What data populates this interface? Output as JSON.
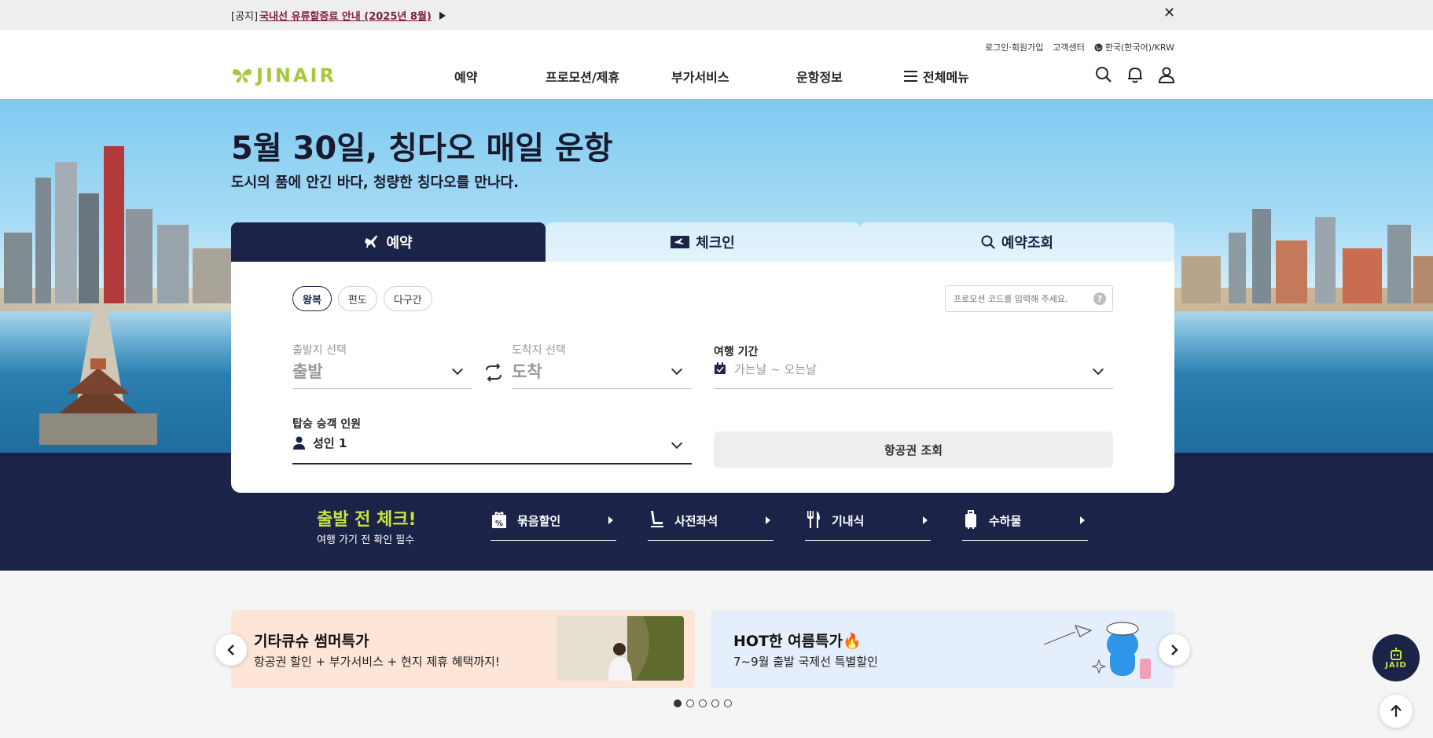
{
  "notice": {
    "prefix": "[공지]",
    "link": "국내선 유류할증료 안내 (2025년 8월)"
  },
  "header": {
    "util_links": [
      "로그인·회원가입",
      "고객센터",
      "한국(한국어)/KRW"
    ],
    "logo_text": "JINAIR",
    "nav": [
      "예약",
      "프로모션/제휴",
      "부가서비스",
      "운항정보",
      "전체메뉴"
    ]
  },
  "hero": {
    "title": "5월 30일, 칭다오 매일 운항",
    "subtitle": "도시의 품에 안긴 바다, 청량한 칭다오를 만나다."
  },
  "booking": {
    "tabs": [
      "예약",
      "체크인",
      "예약조회"
    ],
    "active_tab": "예약",
    "trip_types": [
      "왕복",
      "편도",
      "다구간"
    ],
    "selected_trip_type": "왕복",
    "promo_placeholder": "프로모션 코드를 입력해 주세요.",
    "promo_help": "?",
    "departure_label": "출발지 선택",
    "departure_value": "출발",
    "arrival_label": "도착지 선택",
    "arrival_value": "도착",
    "period_label": "여행 기간",
    "period_value": "가는날 ~ 오는날",
    "pax_label": "탑승 승객 인원",
    "pax_value": "성인 1",
    "search_button": "항공권 조회"
  },
  "pre_departure": {
    "title": "출발 전 체크!",
    "subtitle": "여행 가기 전 확인 필수",
    "items": [
      "묶음할인",
      "사전좌석",
      "기내식",
      "수하물"
    ]
  },
  "banners": [
    {
      "title": "기타큐슈 썸머특가",
      "subtitle": "항공권 할인 + 부가서비스 + 현지 제휴 혜택까지!"
    },
    {
      "title": "HOT한 여름특가🔥",
      "subtitle": "7~9월 출발 국제선 특별할인"
    }
  ],
  "carousel": {
    "page_count": 5,
    "active_index": 0
  },
  "floating": {
    "jaid_label": "JAID"
  },
  "colors": {
    "navy": "#1b2448",
    "brand_green": "#a6c93b",
    "accent_lime": "#c6e43c"
  }
}
